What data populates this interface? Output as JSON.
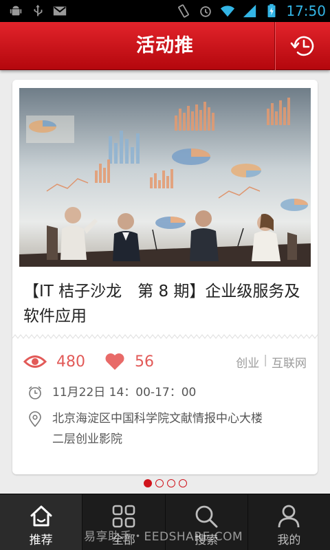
{
  "status_bar": {
    "time": "17:50",
    "icons": [
      "android-debug-icon",
      "usb-icon",
      "gmail-icon",
      "vibrate-icon",
      "alarm-icon",
      "wifi-icon",
      "signal-icon",
      "battery-charging-icon"
    ]
  },
  "header": {
    "title": "活动推",
    "history_icon": "history-clock-icon"
  },
  "event": {
    "title": "【IT 桔子沙龙　第 8 期】企业级服务及软件应用",
    "views": "480",
    "likes": "56",
    "tags": [
      "创业",
      "互联网"
    ],
    "time": "11月22日  14：00-17：00",
    "location_line1": "北京海淀区中国科学院文献情报中心大楼",
    "location_line2": "二层创业影院"
  },
  "pager": {
    "count": 4,
    "active": 0
  },
  "bottom_nav": {
    "items": [
      {
        "label": "推荐",
        "icon": "home-icon",
        "active": true
      },
      {
        "label": "全部",
        "icon": "grid-icon",
        "active": false
      },
      {
        "label": "搜索",
        "icon": "search-icon",
        "active": false
      },
      {
        "label": "我的",
        "icon": "person-icon",
        "active": false
      }
    ]
  },
  "watermark": "易享助手・EEDSHARE.COM",
  "colors": {
    "header_red": "#d0141c",
    "accent_red": "#e25a58",
    "status_blue": "#33b5e5",
    "nav_dark": "#1c1c1c"
  }
}
